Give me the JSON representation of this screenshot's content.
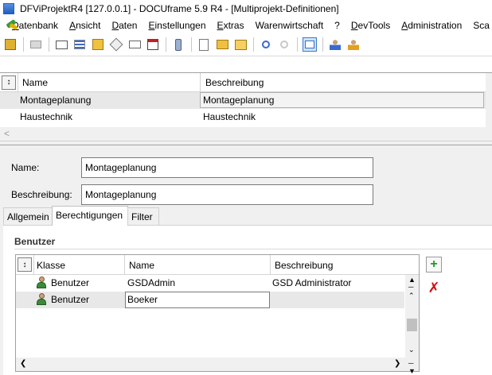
{
  "window": {
    "title": "DFViProjektR4 [127.0.0.1] - DOCUframe 5.9 R4 - [Multiprojekt-Definitionen]"
  },
  "menu": {
    "items": [
      {
        "label": "Datenbank"
      },
      {
        "label": "Ansicht"
      },
      {
        "label": "Daten"
      },
      {
        "label": "Einstellungen"
      },
      {
        "label": "Extras"
      },
      {
        "label": "Warenwirtschaft"
      },
      {
        "label": "?"
      },
      {
        "label": "DevTools"
      },
      {
        "label": "Administration"
      },
      {
        "label": "Sca"
      }
    ]
  },
  "toolbar": {
    "icons": [
      "new-icon",
      "print-icon",
      "card-icon",
      "list-icon",
      "folder-icon",
      "tag-icon",
      "calendar-icon",
      "phone-icon",
      "document-icon",
      "envelope-icon",
      "folder-open-icon",
      "search-icon",
      "search-disabled-icon",
      "view-icon",
      "users-icon",
      "user-edit-icon"
    ]
  },
  "projects_grid": {
    "columns": [
      "Name",
      "Beschreibung"
    ],
    "rows": [
      {
        "name": "Montageplanung",
        "beschreibung": "Montageplanung",
        "selected": true
      },
      {
        "name": "Haustechnik",
        "beschreibung": "Haustechnik",
        "selected": false
      }
    ],
    "scroll_left": "<"
  },
  "form": {
    "name_label": "Name:",
    "name_value": "Montageplanung",
    "beschreibung_label": "Beschreibung:",
    "beschreibung_value": "Montageplanung"
  },
  "tabs": [
    {
      "label": "Allgemein",
      "active": false
    },
    {
      "label": "Berechtigungen",
      "active": true
    },
    {
      "label": "Filter",
      "active": false
    }
  ],
  "benutzer_group": {
    "title": "Benutzer",
    "columns": [
      "Klasse",
      "Name",
      "Beschreibung"
    ],
    "rows": [
      {
        "klasse": "Benutzer",
        "name": "GSDAdmin",
        "beschreibung": "GSD Administrator"
      },
      {
        "klasse": "Benutzer",
        "name": "Boeker",
        "beschreibung": ""
      }
    ]
  },
  "colors": {
    "selection": "#e8e8e8",
    "add": "#1f9a1f",
    "delete": "#d01010"
  }
}
